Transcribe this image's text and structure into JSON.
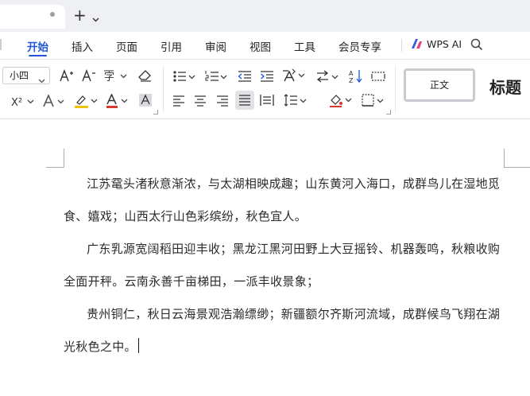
{
  "tabs": {
    "add_label": "+"
  },
  "menu": {
    "items": [
      "开始",
      "插入",
      "页面",
      "引用",
      "审阅",
      "视图",
      "工具",
      "会员专享"
    ],
    "active_index": 0,
    "wps_ai_label": "WPS AI"
  },
  "ribbon": {
    "font_size": "小四",
    "styles": {
      "normal": "正文",
      "title": "标题"
    }
  },
  "document": {
    "paragraphs": [
      "江苏鼋头渚秋意渐浓，与太湖相映成趣；山东黄河入海口，成群鸟儿在湿地觅食、嬉戏；山西太行山色彩缤纷，秋色宜人。",
      "广东乳源宽阔稻田迎丰收；黑龙江黑河田野上大豆摇铃、机器轰鸣，秋粮收购全面开秤。云南永善千亩梯田，一派丰收景象；",
      "贵州铜仁，秋日云海景观浩瀚缥缈；新疆额尔齐斯河流域，成群候鸟飞翔在湖光秋色之中。"
    ]
  },
  "colors": {
    "accent": "#1f59d6",
    "font_color_bar": "#d43a2f",
    "highlight_bar": "#f2c200"
  }
}
